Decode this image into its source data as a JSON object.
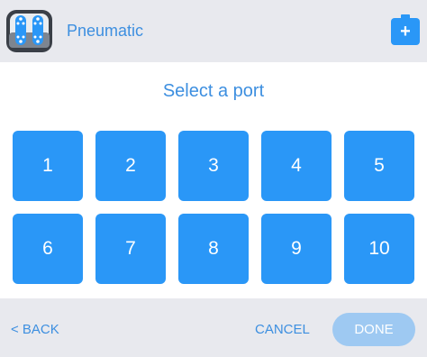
{
  "header": {
    "title": "Pneumatic",
    "device_icon": "pneumatic-device-icon",
    "add_icon": "add-icon",
    "add_symbol": "+"
  },
  "main": {
    "prompt": "Select a port",
    "ports": [
      "1",
      "2",
      "3",
      "4",
      "5",
      "6",
      "7",
      "8",
      "9",
      "10"
    ]
  },
  "footer": {
    "back_label": "< BACK",
    "cancel_label": "CANCEL",
    "done_label": "DONE"
  },
  "colors": {
    "accent": "#2a97f7",
    "text_accent": "#3d8fe0",
    "header_bg": "#e8e9ee",
    "done_disabled": "#9ec9f2"
  }
}
